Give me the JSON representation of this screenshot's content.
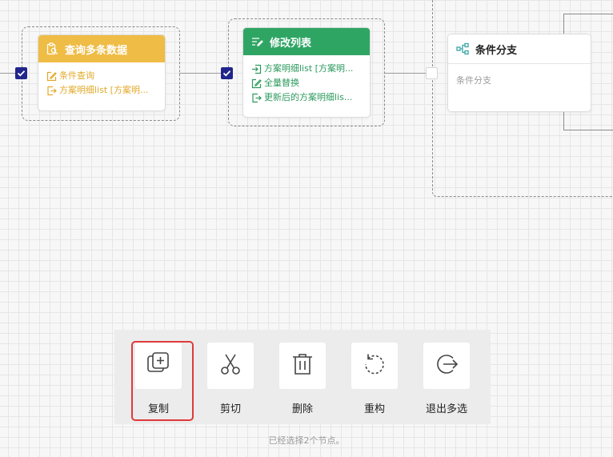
{
  "nodes": {
    "query": {
      "title": "查询多条数据",
      "rows": [
        "条件查询",
        "方案明细list [方案明..."
      ],
      "header_color": "#efbc45",
      "icons": [
        "clipboard-search-icon",
        "edit-icon",
        "export-icon"
      ]
    },
    "modify": {
      "title": "修改列表",
      "rows": [
        "方案明细list [方案明...",
        "全量替换",
        "更新后的方案明细lis..."
      ],
      "header_color": "#2fa564",
      "icons": [
        "list-edit-icon",
        "import-icon",
        "edit-icon",
        "export-icon"
      ]
    },
    "branch": {
      "title": "条件分支",
      "body": "条件分支",
      "icons": [
        "branch-icon"
      ]
    }
  },
  "toolbar": {
    "items": [
      {
        "label": "复制",
        "icon": "copy-icon",
        "selected": true
      },
      {
        "label": "剪切",
        "icon": "scissors-icon"
      },
      {
        "label": "删除",
        "icon": "trash-icon"
      },
      {
        "label": "重构",
        "icon": "rotate-icon"
      },
      {
        "label": "退出多选",
        "icon": "exit-icon"
      }
    ]
  },
  "status_text": "已经选择2个节点。",
  "colors": {
    "selected_border": "#e03a3a",
    "checkbox": "#20268c"
  }
}
